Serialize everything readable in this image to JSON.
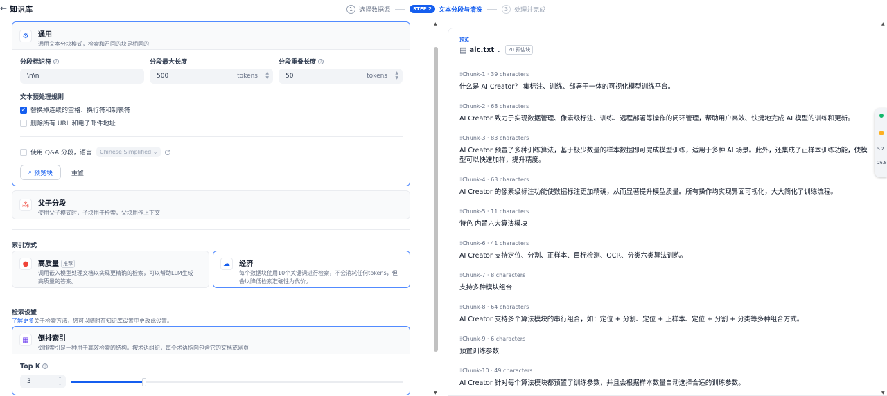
{
  "header": {
    "back_icon": "arrow-left-icon",
    "title": "知识库",
    "steps": [
      {
        "num": "1",
        "label": "选择数据源",
        "state": "done"
      },
      {
        "num": "STEP 2",
        "label": "文本分段与清洗",
        "state": "active"
      },
      {
        "num": "3",
        "label": "处理并完成",
        "state": "disabled"
      }
    ]
  },
  "segmentation": {
    "general": {
      "title": "通用",
      "desc": "通用文本分块模式，检索和召回的块是相同的",
      "delimiter_label": "分段标识符",
      "delimiter_value": "\\n\\n",
      "max_len_label": "分段最大长度",
      "max_len_value": "500",
      "max_len_unit": "tokens",
      "overlap_label": "分段重叠长度",
      "overlap_value": "50",
      "overlap_unit": "tokens",
      "preprocess_label": "文本预处理规则",
      "rule1": "替换掉连续的空格、换行符和制表符",
      "rule1_checked": true,
      "rule2": "删除所有 URL 和电子邮件地址",
      "rule2_checked": false,
      "qa_label": "使用 Q&A 分段，语言",
      "qa_lang": "Chinese Simplified",
      "preview_button": "预览块",
      "reset_button": "重置"
    },
    "parent_child": {
      "title": "父子分段",
      "desc": "使用父子模式时，子块用于检索，父块用作上下文"
    }
  },
  "index": {
    "label": "索引方式",
    "high_quality": {
      "title": "高质量",
      "badge": "推荐",
      "desc_line1": "调用嵌入模型处理文档以实现更精确的检索，可以帮助LLM生成",
      "desc_line2": "高质量的答案。"
    },
    "economy": {
      "title": "经济",
      "desc_line1": "每个数据块使用10个关键词进行检索，不会消耗任何tokens，但",
      "desc_line2": "会以降低检索准确性为代价。"
    }
  },
  "retrieval": {
    "label": "检索设置",
    "learn_more": "了解更多",
    "learn_more_suffix": "关于检索方法，您可以随时在知识库设置中更改此设置。",
    "inverted": {
      "title": "倒排索引",
      "desc": "倒排索引是一种用于高效检索的结构。按术语组织，每个术语指向包含它的文档或网页"
    },
    "topk_label": "Top K",
    "topk_value": "3",
    "topk_fraction": 0.22
  },
  "preview": {
    "tag": "预览",
    "file_name": "aic.txt",
    "chunk_count": "20 预估块",
    "chunks": [
      {
        "id": "Chunk-1",
        "chars": "39 characters",
        "text": "什么是 AI Creator？ 集标注、训练、部署于一体的可视化模型训练平台。"
      },
      {
        "id": "Chunk-2",
        "chars": "68 characters",
        "text": "AI Creator 致力于实现数据管理、像素级标注、训练、远程部署等操作的闭环管理，帮助用户高效、快捷地完成 AI 模型的训练和更新。"
      },
      {
        "id": "Chunk-3",
        "chars": "83 characters",
        "text": "AI Creator 预置了多种训练算法，基于极少数量的样本数据即可完成模型训练，适用于多种 AI 场景。此外，还集成了正样本训练功能，使模型可以快速加样，提升精度。"
      },
      {
        "id": "Chunk-4",
        "chars": "63 characters",
        "text": "AI Creator 的像素级标注功能使数据标注更加精确，从而显著提升模型质量。所有操作均实现界面可视化，大大简化了训练流程。"
      },
      {
        "id": "Chunk-5",
        "chars": "11 characters",
        "text": "特色 内置六大算法模块"
      },
      {
        "id": "Chunk-6",
        "chars": "41 characters",
        "text": "AI Creator 支持定位、分割、正样本、目标检测、OCR、分类六类算法训练。"
      },
      {
        "id": "Chunk-7",
        "chars": "8 characters",
        "text": "支持多种模块组合"
      },
      {
        "id": "Chunk-8",
        "chars": "64 characters",
        "text": "AI Creator 支持多个算法模块的串行组合，如：定位 + 分割、定位 + 正样本、定位 + 分割 + 分类等多种组合方式。"
      },
      {
        "id": "Chunk-9",
        "chars": "6 characters",
        "text": "预置训练参数"
      },
      {
        "id": "Chunk-10",
        "chars": "49 characters",
        "text": "AI Creator 针对每个算法模块都预置了训练参数，并且会根据样本数量自动选择合适的训练参数。"
      }
    ]
  },
  "widget": {
    "line1": "5.2",
    "line2": "26.8"
  },
  "colors": {
    "accent": "#155eef",
    "border_selected": "#528bff",
    "orange": "#f04438",
    "green": "#12b76a"
  }
}
